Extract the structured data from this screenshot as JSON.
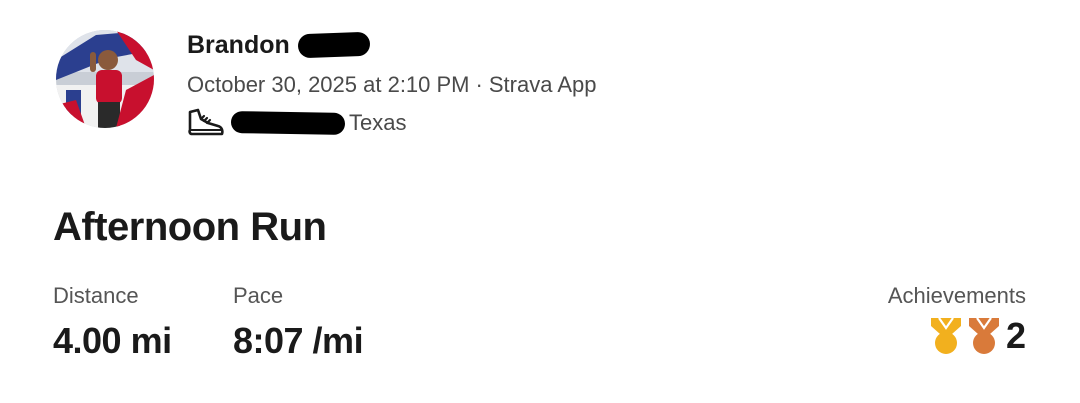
{
  "athlete": {
    "name": "Brandon"
  },
  "activity": {
    "date_time": "October 30, 2025 at 2:10 PM",
    "separator": "·",
    "source": "Strava App",
    "location_state": "Texas",
    "activity_icon": "running-shoe-icon",
    "title": "Afternoon Run"
  },
  "stats": {
    "distance_label": "Distance",
    "distance_value": "4.00 mi",
    "pace_label": "Pace",
    "pace_value": "8:07 /mi",
    "achievements_label": "Achievements",
    "achievements_count": "2",
    "achievement_medals": [
      "gold-medal-icon",
      "bronze-medal-icon"
    ]
  },
  "colors": {
    "gold_medal": "#F2B01E",
    "bronze_medal": "#D97A3A"
  }
}
